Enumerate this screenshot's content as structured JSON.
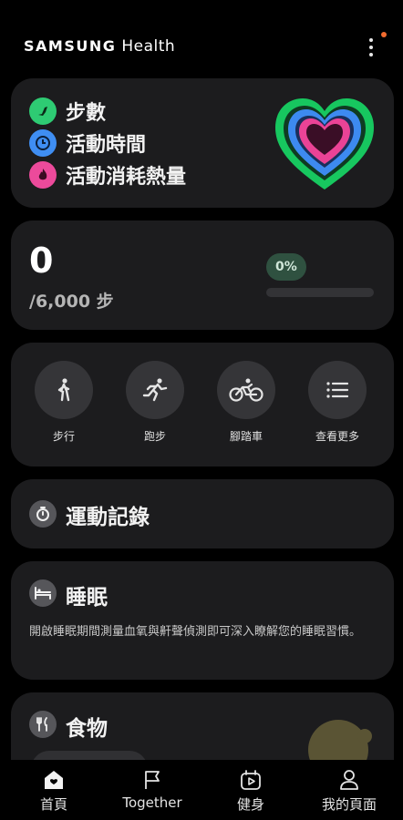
{
  "header": {
    "brand_primary": "SAMSUNG",
    "brand_secondary": "Health",
    "notification_color": "#f26b2f"
  },
  "activity": {
    "items": [
      {
        "label": "步數",
        "icon": "steps-icon",
        "color": "#2ecb73"
      },
      {
        "label": "活動時間",
        "icon": "clock-icon",
        "color": "#3f8ef2"
      },
      {
        "label": "活動消耗熱量",
        "icon": "flame-icon",
        "color": "#ec4a9b"
      }
    ]
  },
  "steps": {
    "value": "0",
    "goal": "/6,000 步",
    "percent_label": "0%",
    "progress_fraction": 0
  },
  "quick_start": {
    "items": [
      {
        "label": "步行",
        "icon": "walking-icon"
      },
      {
        "label": "跑步",
        "icon": "running-icon"
      },
      {
        "label": "腳踏車",
        "icon": "bicycle-icon"
      },
      {
        "label": "查看更多",
        "icon": "list-icon"
      }
    ]
  },
  "exercise": {
    "title": "運動記錄",
    "icon": "stopwatch-icon"
  },
  "sleep": {
    "title": "睡眠",
    "icon": "bed-icon",
    "description": "開啟睡眠期間測量血氧與鼾聲偵測即可深入瞭解您的睡眠習慣。"
  },
  "food": {
    "title": "食物",
    "icon": "utensils-icon"
  },
  "nav": {
    "items": [
      {
        "label": "首頁",
        "icon": "home-icon",
        "active": true
      },
      {
        "label": "Together",
        "icon": "flag-icon",
        "active": false
      },
      {
        "label": "健身",
        "icon": "fitness-icon",
        "active": false
      },
      {
        "label": "我的頁面",
        "icon": "person-icon",
        "active": false
      }
    ]
  }
}
